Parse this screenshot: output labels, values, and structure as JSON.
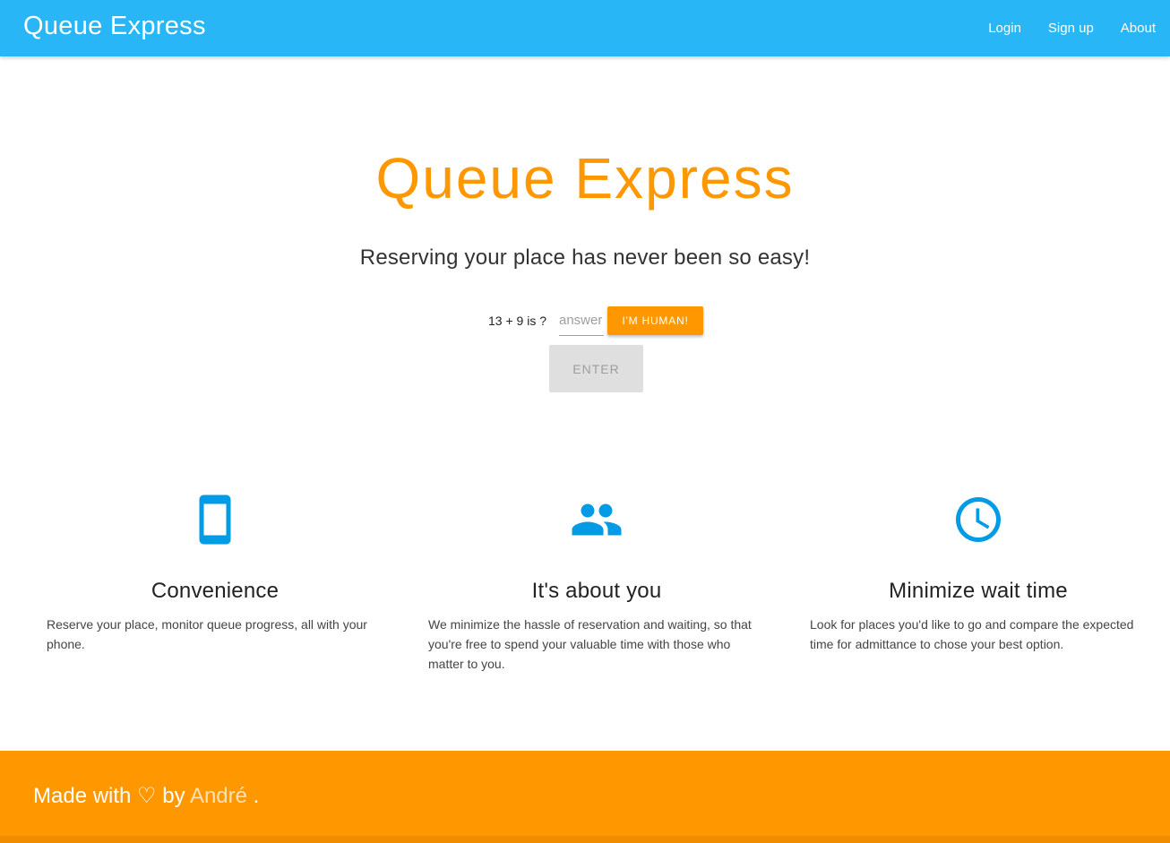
{
  "nav": {
    "brand": "Queue Express",
    "links": [
      "Login",
      "Sign up",
      "About"
    ]
  },
  "hero": {
    "title": "Queue Express",
    "subtitle": "Reserving your place has never been so easy!"
  },
  "captcha": {
    "question": "13 + 9 is ?",
    "placeholder": "answer",
    "human_button": "I'M HUMAN!",
    "enter_button": "ENTER"
  },
  "features": [
    {
      "icon": "smartphone-icon",
      "title": "Convenience",
      "text": "Reserve your place, monitor queue progress, all with your phone."
    },
    {
      "icon": "people-icon",
      "title": "It's about you",
      "text": "We minimize the hassle of reservation and waiting, so that you're free to spend your valuable time with those who matter to you."
    },
    {
      "icon": "clock-icon",
      "title": "Minimize wait time",
      "text": "Look for places you'd like to go and compare the expected time for admittance to chose your best option."
    }
  ],
  "footer": {
    "prefix": "Made with ♡ by",
    "author": "André",
    "suffix": "."
  },
  "colors": {
    "navbar": "#29b6f6",
    "accent": "#ff9800",
    "icon": "#039be5"
  }
}
